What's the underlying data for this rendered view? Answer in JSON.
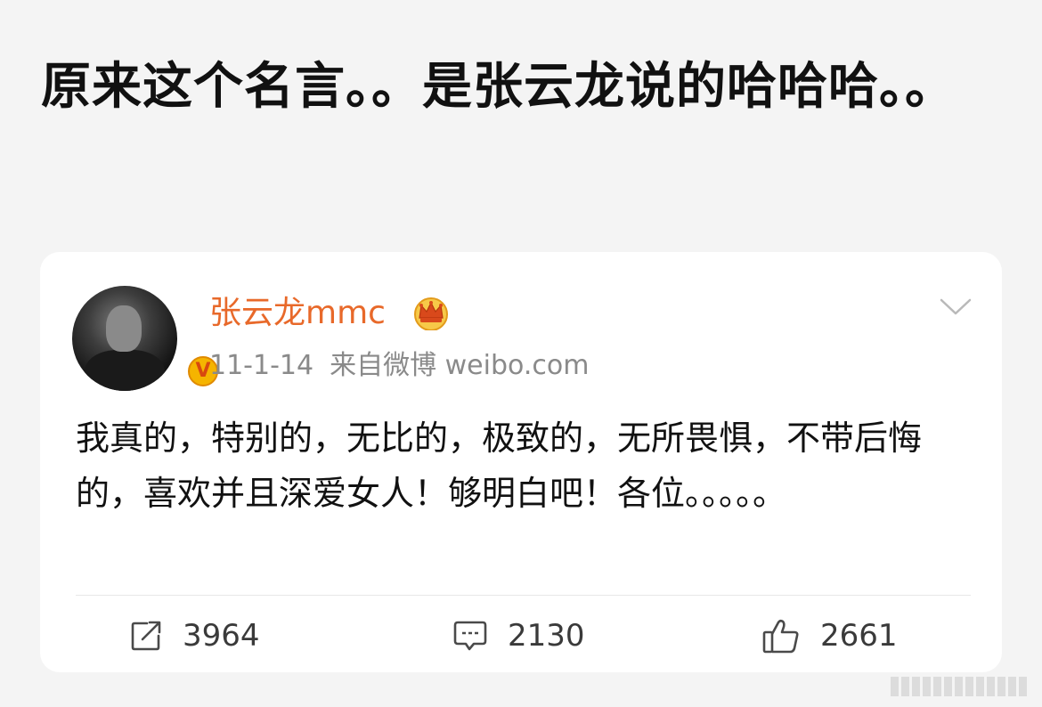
{
  "headline": "原来这个名言。。是张云龙说的哈哈哈。。",
  "post": {
    "username": "张云龙mmc",
    "date": "11-1-14",
    "source": "来自微博 weibo.com",
    "verified_badge": "V",
    "text": "我真的，特别的，无比的，极致的，无所畏惧，不带后悔的，喜欢并且深爱女人！够明白吧！各位。。。。。",
    "actions": {
      "repost_count": "3964",
      "comment_count": "2130",
      "like_count": "2661"
    }
  },
  "icons": {
    "crown": "crown-icon",
    "chevron": "chevron-down-icon",
    "repost": "repost-icon",
    "comment": "comment-icon",
    "like": "thumbs-up-icon"
  },
  "colors": {
    "username": "#e8692a",
    "meta": "#8a8a8a",
    "badge": "#f5b400",
    "background": "#f4f4f4",
    "card": "#ffffff"
  }
}
